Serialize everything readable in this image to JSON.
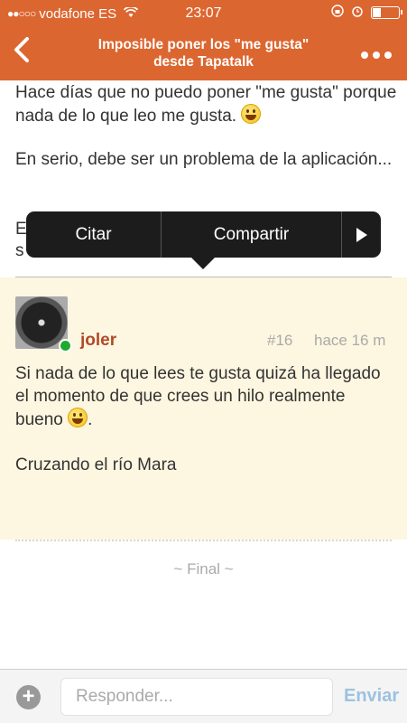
{
  "status_bar": {
    "signal": "●●○○○",
    "carrier": "vodafone ES",
    "time": "23:07"
  },
  "header": {
    "title_line1": "Imposible poner los \"me gusta\"",
    "title_line2": "desde Tapatalk",
    "back_icon": "chevron-left-icon",
    "more_icon": "more-dots-icon"
  },
  "previous_post": {
    "paragraph1": "Hace días que no puedo poner \"me gusta\" porque nada de lo que leo me gusta.",
    "paragraph2": "En serio, debe ser un problema de la aplicación...",
    "partial_line1": "E",
    "partial_line2": "s"
  },
  "context_menu": {
    "quote": "Citar",
    "share": "Compartir"
  },
  "post": {
    "username": "joler",
    "number": "#16",
    "time": "hace 16 m",
    "body_line": "Si nada de lo que lees te gusta quizá ha llegado el momento de que crees un hilo realmente bueno",
    "body_end": ".",
    "signature": "Cruzando el río Mara"
  },
  "footer": {
    "end_label": "~ Final ~"
  },
  "reply_bar": {
    "placeholder": "Responder...",
    "send_label": "Enviar"
  },
  "colors": {
    "accent": "#dc6630",
    "highlight_bg": "#fdf6e0",
    "username": "#b04a2a",
    "online": "#1faa2e",
    "send": "#9cc2e0"
  }
}
